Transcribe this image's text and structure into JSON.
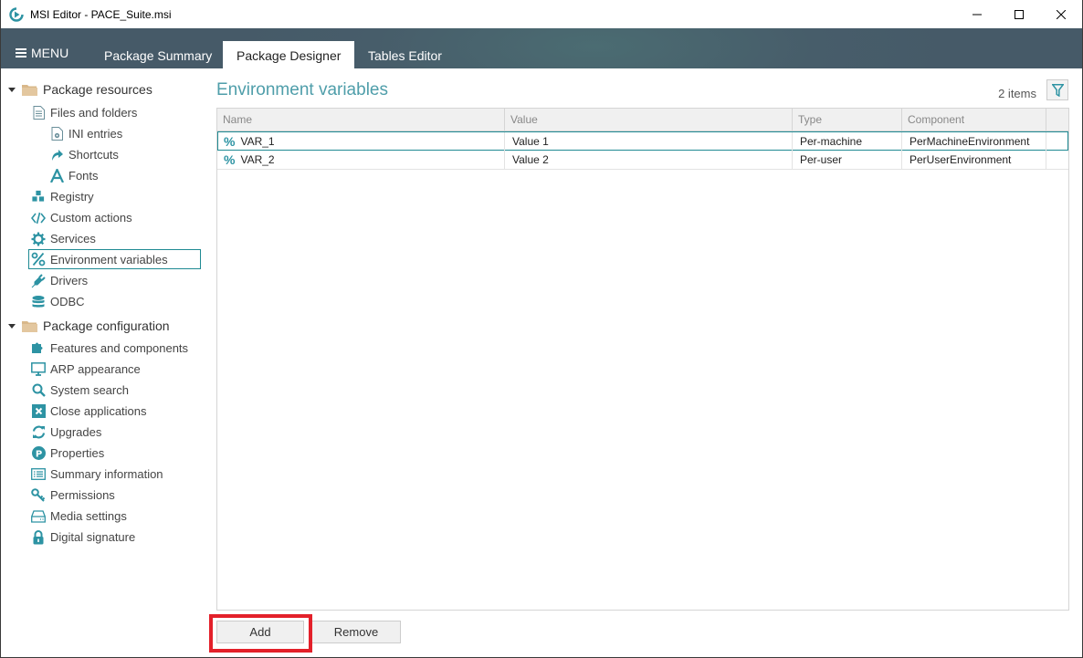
{
  "window": {
    "title": "MSI Editor - PACE_Suite.msi",
    "controls": {
      "minimize": "minimize-icon",
      "maximize": "maximize-icon",
      "close": "close-icon"
    }
  },
  "nav": {
    "menu_label": "MENU",
    "tabs": [
      {
        "label": "Package Summary",
        "active": false
      },
      {
        "label": "Package Designer",
        "active": true
      },
      {
        "label": "Tables Editor",
        "active": false
      }
    ]
  },
  "sidebar": {
    "groups": [
      {
        "label": "Package resources",
        "items": [
          {
            "label": "Files and folders",
            "icon": "document-icon",
            "level": 1
          },
          {
            "label": "INI entries",
            "icon": "ini-file-icon",
            "level": 2
          },
          {
            "label": "Shortcuts",
            "icon": "shortcut-arrow-icon",
            "level": 2
          },
          {
            "label": "Fonts",
            "icon": "font-icon",
            "level": 2
          },
          {
            "label": "Registry",
            "icon": "registry-cubes-icon",
            "level": 1
          },
          {
            "label": "Custom actions",
            "icon": "code-icon",
            "level": 1
          },
          {
            "label": "Services",
            "icon": "gear-icon",
            "level": 1
          },
          {
            "label": "Environment variables",
            "icon": "percent-icon",
            "level": 1,
            "selected": true
          },
          {
            "label": "Drivers",
            "icon": "plug-icon",
            "level": 1
          },
          {
            "label": "ODBC",
            "icon": "database-icon",
            "level": 1
          }
        ]
      },
      {
        "label": "Package configuration",
        "items": [
          {
            "label": "Features and components",
            "icon": "puzzle-icon",
            "level": 1
          },
          {
            "label": "ARP appearance",
            "icon": "monitor-icon",
            "level": 1
          },
          {
            "label": "System search",
            "icon": "search-icon",
            "level": 1
          },
          {
            "label": "Close applications",
            "icon": "close-box-icon",
            "level": 1
          },
          {
            "label": "Upgrades",
            "icon": "refresh-icon",
            "level": 1
          },
          {
            "label": "Properties",
            "icon": "properties-p-icon",
            "level": 1
          },
          {
            "label": "Summary information",
            "icon": "list-icon",
            "level": 1
          },
          {
            "label": "Permissions",
            "icon": "key-icon",
            "level": 1
          },
          {
            "label": "Media settings",
            "icon": "drive-icon",
            "level": 1
          },
          {
            "label": "Digital signature",
            "icon": "lock-icon",
            "level": 1
          }
        ]
      }
    ]
  },
  "content": {
    "title": "Environment variables",
    "item_count": "2 items",
    "filter_icon": "filter-icon",
    "columns": [
      "Name",
      "Value",
      "Type",
      "Component"
    ],
    "rows": [
      {
        "name": "VAR_1",
        "value": "Value 1",
        "type": "Per-machine",
        "component": "PerMachineEnvironment",
        "selected": true
      },
      {
        "name": "VAR_2",
        "value": "Value 2",
        "type": "Per-user",
        "component": "PerUserEnvironment",
        "selected": false
      }
    ],
    "buttons": {
      "add": "Add",
      "remove": "Remove"
    }
  },
  "colors": {
    "accent": "#2d93a3",
    "title": "#4f9eaa",
    "navbar": "#475d6a",
    "highlight": "#e3202a",
    "selection_border": "#1f8a93"
  }
}
